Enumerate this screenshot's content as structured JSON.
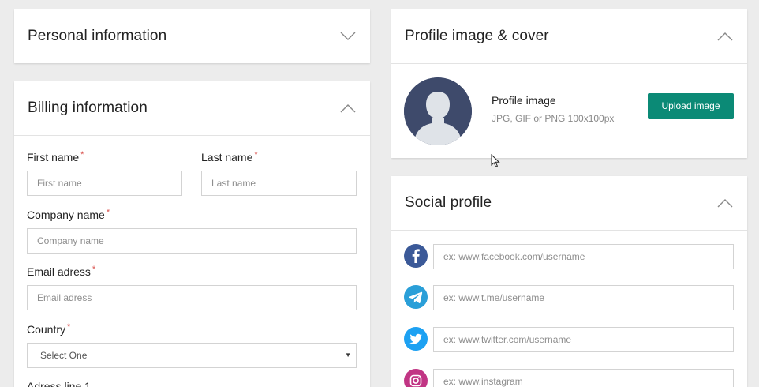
{
  "personal": {
    "title": "Personal information"
  },
  "billing": {
    "title": "Billing information",
    "first_name": {
      "label": "First name",
      "required": "*",
      "placeholder": "First name"
    },
    "last_name": {
      "label": "Last name",
      "required": "*",
      "placeholder": "Last name"
    },
    "company": {
      "label": "Company name",
      "required": "*",
      "placeholder": "Company name"
    },
    "email": {
      "label": "Email adress",
      "required": "*",
      "placeholder": "Email adress"
    },
    "country": {
      "label": "Country",
      "required": "*",
      "selected": "Select One",
      "arrow": "▼"
    },
    "address1": {
      "label": "Adress line 1"
    }
  },
  "profile": {
    "title": "Profile image & cover",
    "image_label": "Profile image",
    "image_hint": "JPG, GIF or PNG 100x100px",
    "upload_label": "Upload image",
    "accent_color": "#0b8a76",
    "avatar_color": "#3e4a6b"
  },
  "social": {
    "title": "Social profile",
    "items": [
      {
        "icon": "facebook-icon",
        "color": "#3b5998",
        "placeholder": "ex: www.facebook.com/username"
      },
      {
        "icon": "telegram-icon",
        "color": "#2a9fd8",
        "placeholder": "ex: www.t.me/username"
      },
      {
        "icon": "twitter-icon",
        "color": "#1da1f2",
        "placeholder": "ex: www.twitter.com/username"
      },
      {
        "icon": "instagram-icon",
        "color": "#c13584",
        "placeholder": "ex: www.instagram"
      }
    ]
  }
}
